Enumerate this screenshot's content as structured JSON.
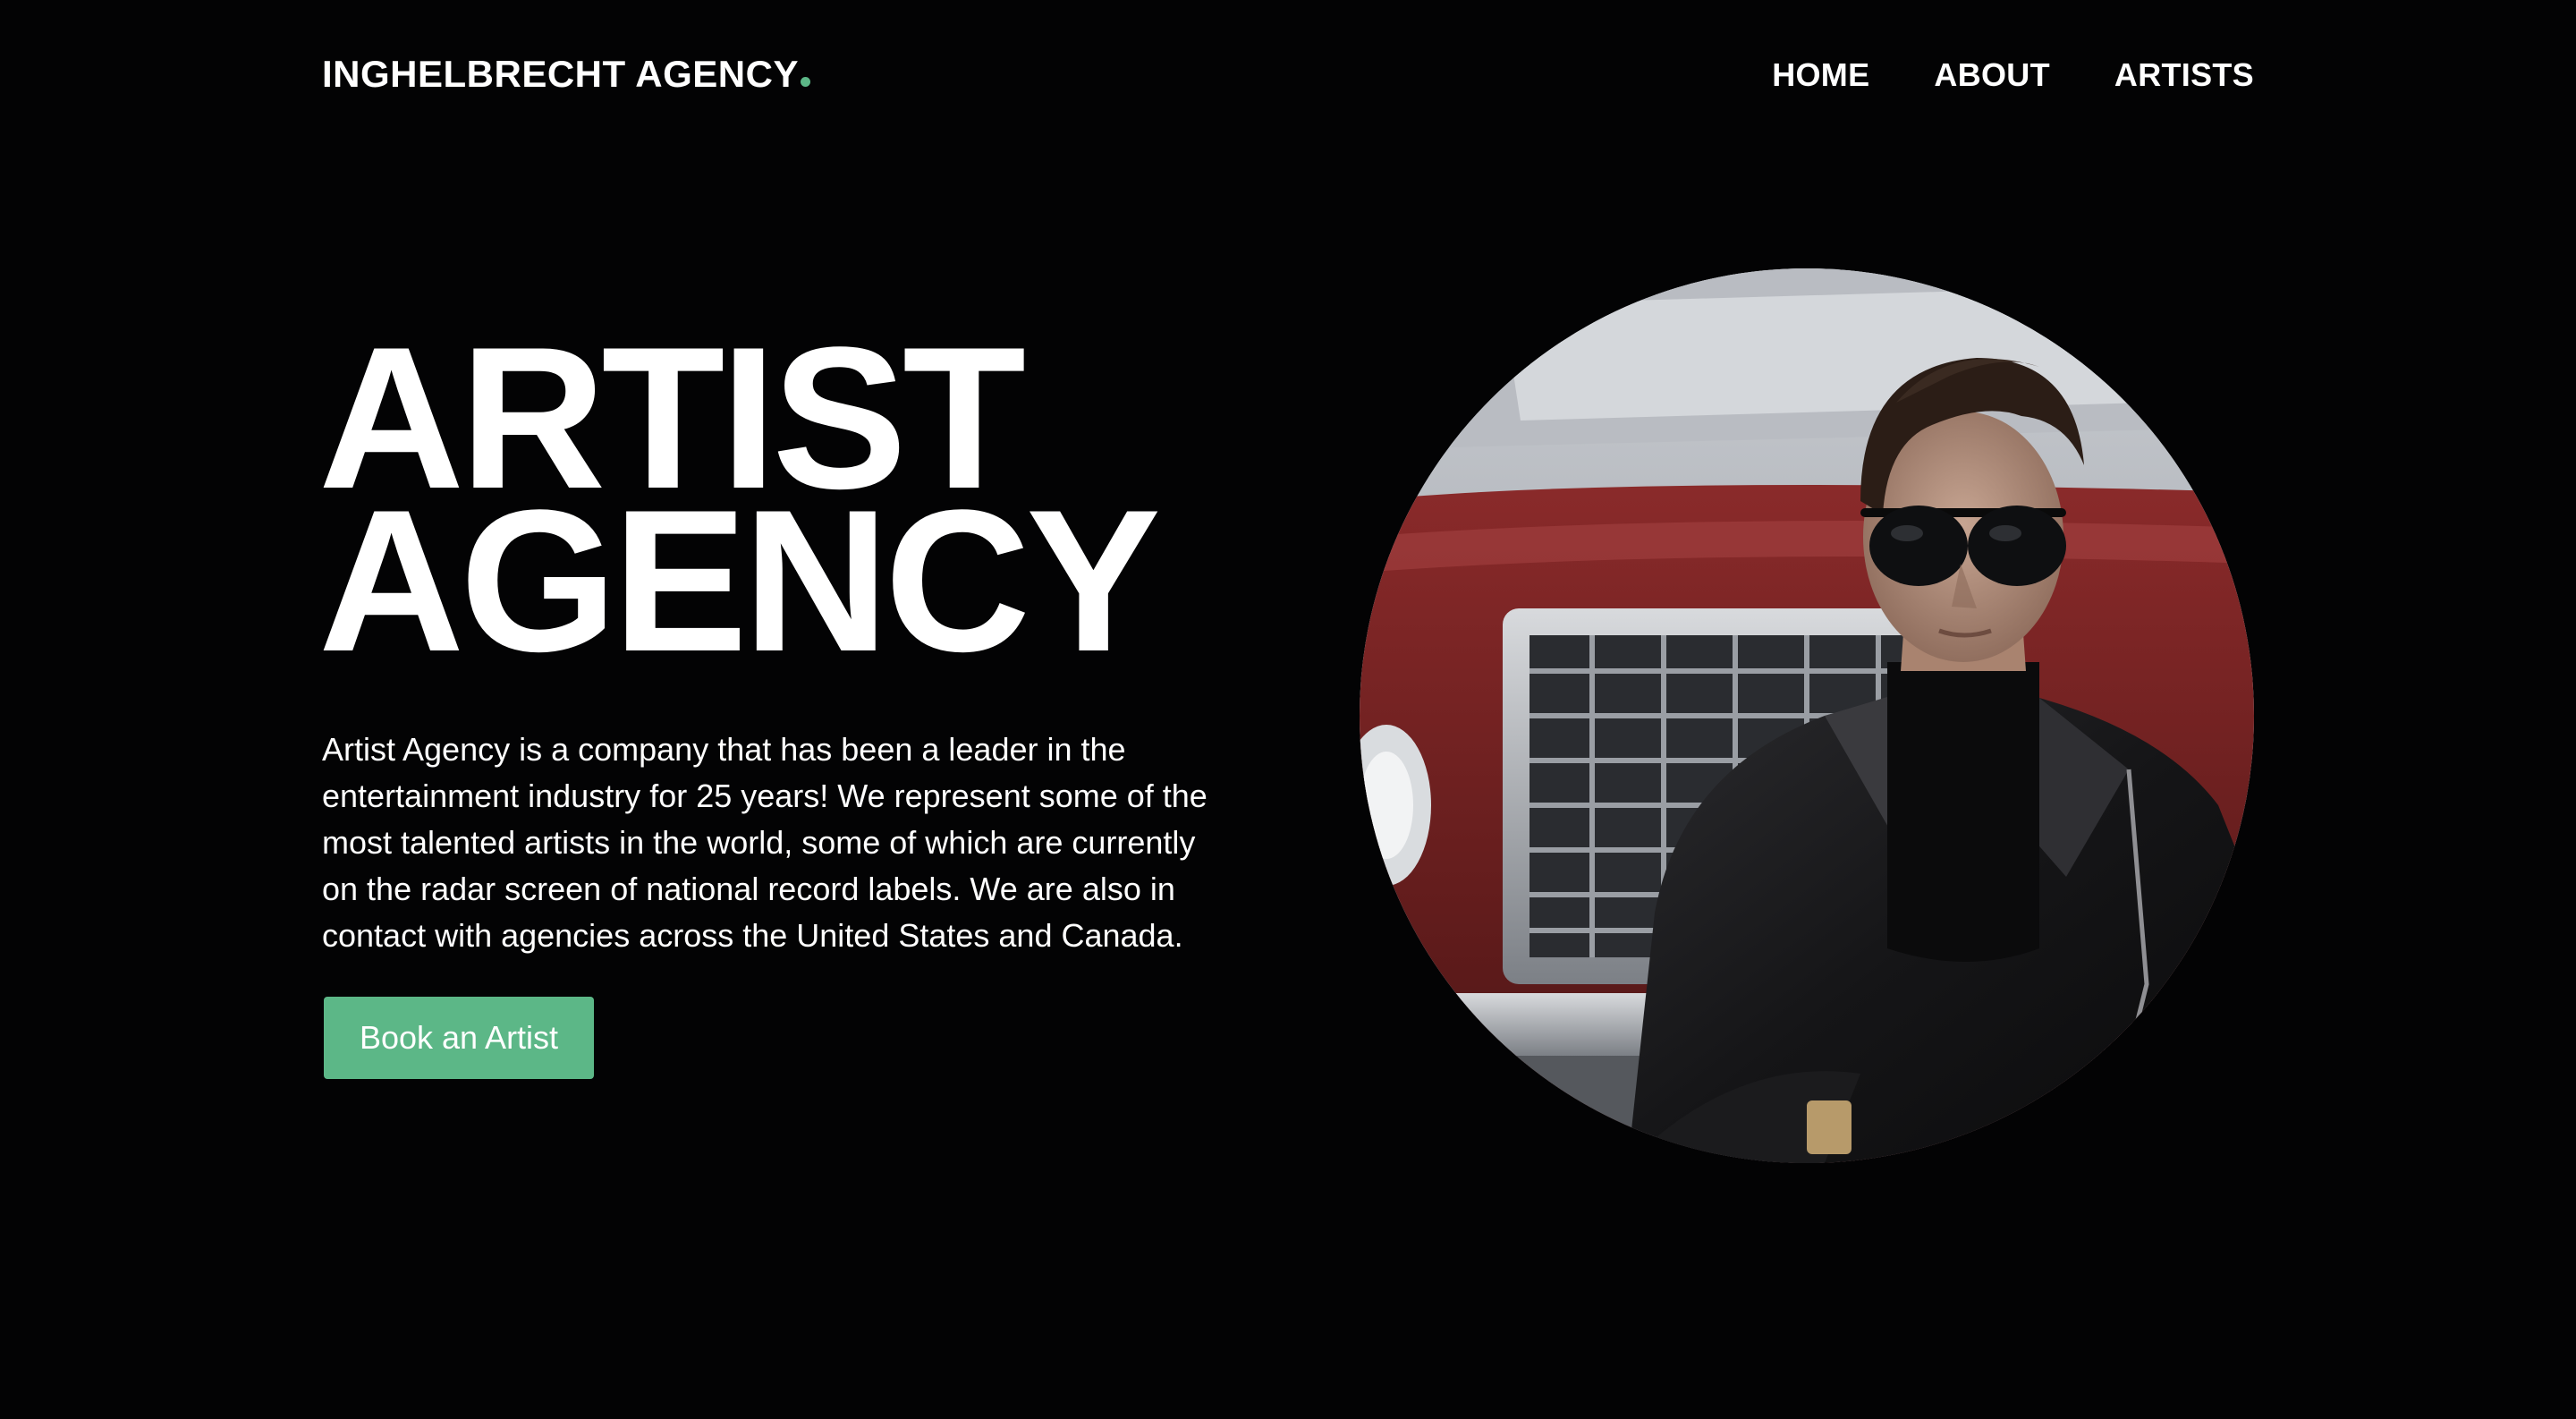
{
  "header": {
    "logo_text": "INGHELBRECHT AGENCY",
    "logo_dot_color": "#5cb787",
    "nav": [
      {
        "label": "HOME"
      },
      {
        "label": "ABOUT"
      },
      {
        "label": "ARTISTS"
      }
    ]
  },
  "hero": {
    "title_line1": "ARTIST",
    "title_line2": "AGENCY",
    "description": "Artist Agency is a company that has been a leader in the entertainment industry for 25 years! We represent some of the most talented artists in the world, some of which are currently on the radar screen of national record labels. We are also in contact with agencies across the United States and Canada.",
    "cta_label": "Book an Artist",
    "cta_color": "#5cb787"
  },
  "portrait": {
    "alt": "Man in sunglasses and black leather jacket in front of a red vintage car"
  },
  "colors": {
    "background": "#030304",
    "text": "#ffffff",
    "accent": "#5cb787"
  }
}
